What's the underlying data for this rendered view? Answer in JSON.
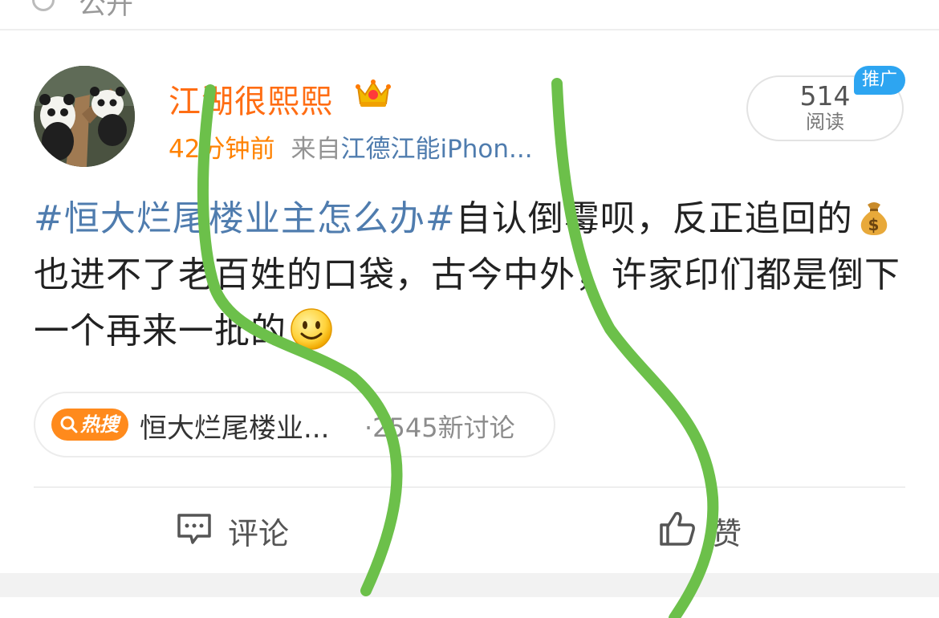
{
  "top_cut": {
    "text": "公开"
  },
  "user": {
    "name": "江湖很熙熙",
    "icons": {
      "crown": "vip-crown-icon",
      "avatar": "panda-avatar"
    }
  },
  "meta": {
    "time": "42分钟前",
    "source_prefix": "来自",
    "source": "江德江能iPhon..."
  },
  "reads": {
    "count": "514",
    "label": "阅读"
  },
  "promo": {
    "label": "推广"
  },
  "post": {
    "hashtag": "#恒大烂尾楼业主怎么办#",
    "text_1": "自认倒霉呗，反正追回的",
    "text_2": "也进不了老百姓的口袋，古今中外，许家印们都是倒下一个再来一批的",
    "emojis": [
      "money-bag-emoji",
      "smile-emoji"
    ]
  },
  "hot_topic": {
    "badge": "热搜",
    "title": "恒大烂尾楼业...",
    "count": "·2545新讨论"
  },
  "actions": {
    "comment": "评论",
    "like": "赞"
  },
  "colors": {
    "username": "#ff6d13",
    "time": "#ff8200",
    "link": "#4f7cae",
    "promo": "#2da5f1",
    "hot_badge": "#ff8a1c",
    "overlay_stroke": "#6cc04a"
  }
}
